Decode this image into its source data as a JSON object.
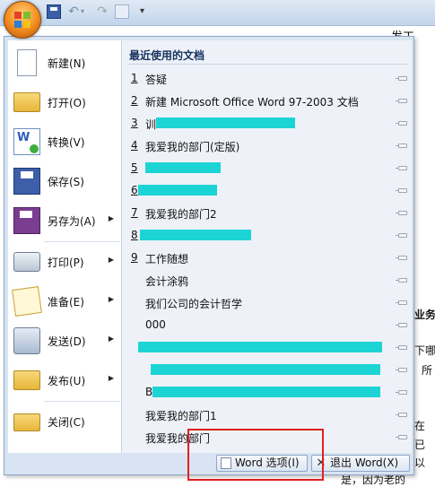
{
  "window": {
    "title_fragment": "发工"
  },
  "quick_access": {
    "save_icon": "save-icon",
    "undo_icon": "undo-icon",
    "redo_icon": "redo-icon",
    "print_preview_icon": "print-preview-icon",
    "customize_icon": "chevron-down-icon"
  },
  "menu": {
    "commands": [
      {
        "label": "新建(N)",
        "icon": "new-document-icon",
        "has_submenu": false
      },
      {
        "label": "打开(O)",
        "icon": "open-folder-icon",
        "has_submenu": false
      },
      {
        "label": "转换(V)",
        "icon": "convert-icon",
        "has_submenu": false
      },
      {
        "label": "保存(S)",
        "icon": "save-icon",
        "has_submenu": false
      },
      {
        "label": "另存为(A)",
        "icon": "save-as-icon",
        "has_submenu": true
      },
      {
        "label": "打印(P)",
        "icon": "printer-icon",
        "has_submenu": true
      },
      {
        "label": "准备(E)",
        "icon": "prepare-icon",
        "has_submenu": true
      },
      {
        "label": "发送(D)",
        "icon": "send-icon",
        "has_submenu": true
      },
      {
        "label": "发布(U)",
        "icon": "publish-icon",
        "has_submenu": true
      },
      {
        "label": "关闭(C)",
        "icon": "close-folder-icon",
        "has_submenu": false
      }
    ],
    "recent_title": "最近使用的文档",
    "recent_documents": [
      {
        "num": "1",
        "name": "答疑"
      },
      {
        "num": "2",
        "name": "新建 Microsoft Office Word 97-2003 文档"
      },
      {
        "num": "3",
        "name": "训"
      },
      {
        "num": "4",
        "name": "我爱我的部门(定版)"
      },
      {
        "num": "5",
        "name": ""
      },
      {
        "num": "6",
        "name": ""
      },
      {
        "num": "7",
        "name": "我爱我的部门2"
      },
      {
        "num": "8",
        "name": ""
      },
      {
        "num": "9",
        "name": "工作随想"
      },
      {
        "num": "",
        "name": "会计涂鸦"
      },
      {
        "num": "",
        "name": "我们公司的会计哲学"
      },
      {
        "num": "",
        "name": "000"
      },
      {
        "num": "",
        "name": ""
      },
      {
        "num": "",
        "name": ""
      },
      {
        "num": "",
        "name": "B"
      },
      {
        "num": "",
        "name": "我爱我的部门1"
      },
      {
        "num": "",
        "name": "我爱我的部门"
      }
    ],
    "word_options_label": "Word 选项(I)",
    "exit_word_label": "退出 Word(X)"
  },
  "document_fragments": [
    "业务",
    "下哪",
    "所",
    "在",
    "已",
    "以",
    "是，因为老的"
  ]
}
